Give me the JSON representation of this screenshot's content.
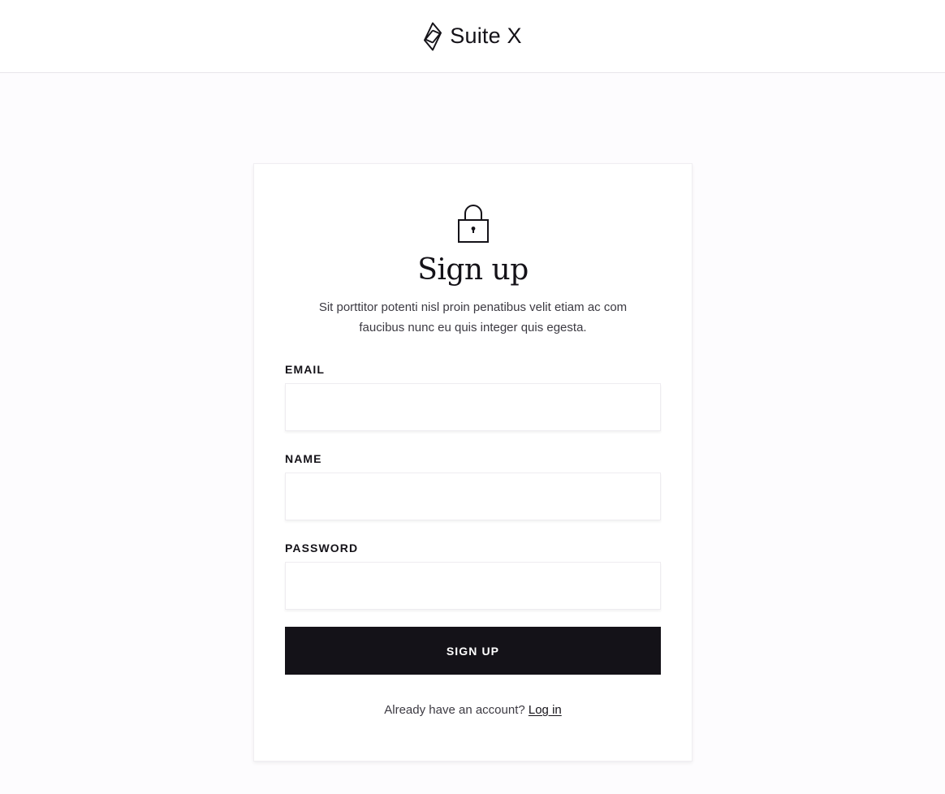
{
  "header": {
    "brand_name": "Suite X",
    "logo_icon": "diamond-leaf-logo-icon"
  },
  "signup": {
    "icon": "lock-icon",
    "title": "Sign up",
    "subtitle": "Sit porttitor potenti nisl proin penatibus velit etiam ac com faucibus nunc eu quis integer quis egesta.",
    "fields": [
      {
        "label": "EMAIL",
        "value": "",
        "placeholder": ""
      },
      {
        "label": "NAME",
        "value": "",
        "placeholder": ""
      },
      {
        "label": "PASSWORD",
        "value": "",
        "placeholder": ""
      }
    ],
    "submit_label": "SIGN UP",
    "footer_prompt": "Already have an account?",
    "login_link": "Log in"
  },
  "colors": {
    "page_background": "#fdfcfe",
    "card_background": "#ffffff",
    "primary_button": "#141218",
    "text_primary": "#141218",
    "text_secondary": "#3c3a42",
    "divider": "#e7e5ea"
  }
}
